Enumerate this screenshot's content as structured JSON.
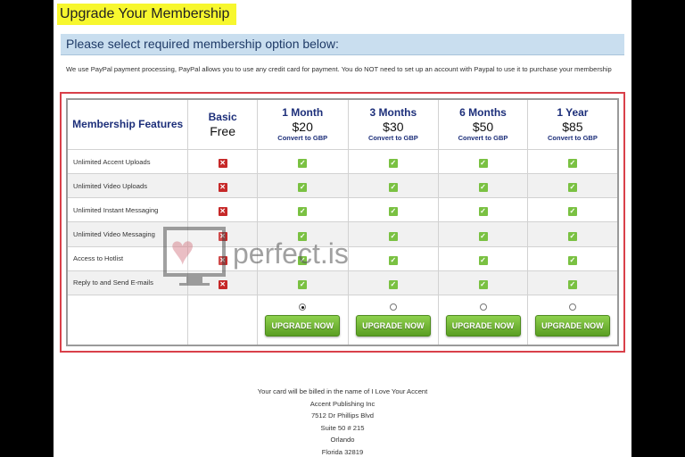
{
  "header": {
    "title": "Upgrade Your Membership",
    "subtitle": "Please select required membership option below:",
    "intro": "We use PayPal payment processing, PayPal allows you to use any credit card for payment. You do NOT need to set up an account with Paypal to use it to purchase your membership"
  },
  "table": {
    "features_header": "Membership Features",
    "plans": [
      {
        "name": "Basic",
        "price": "Free",
        "convert": "",
        "selected": false,
        "upgrade": ""
      },
      {
        "name": "1 Month",
        "price": "$20",
        "convert": "Convert to GBP",
        "selected": true,
        "upgrade": "UPGRADE NOW"
      },
      {
        "name": "3 Months",
        "price": "$30",
        "convert": "Convert to GBP",
        "selected": false,
        "upgrade": "UPGRADE NOW"
      },
      {
        "name": "6 Months",
        "price": "$50",
        "convert": "Convert to GBP",
        "selected": false,
        "upgrade": "UPGRADE NOW"
      },
      {
        "name": "1 Year",
        "price": "$85",
        "convert": "Convert to GBP",
        "selected": false,
        "upgrade": "UPGRADE NOW"
      }
    ],
    "features": [
      "Unlimited Accent Uploads",
      "Unlimited Video Uploads",
      "Unlimited Instant Messaging",
      "Unlimited Video Messaging",
      "Access to Hotlist",
      "Reply to and Send E-mails"
    ],
    "icons": {
      "no": "x-icon",
      "yes": "check-icon"
    }
  },
  "footer": {
    "lines": [
      "Your card will be billed in the name of I Love Your Accent",
      "Accent Publishing Inc",
      "7512 Dr Phillips Blvd",
      "Suite 50 # 215",
      "Orlando",
      "Florida 32819"
    ]
  },
  "watermark": {
    "text": "perfect.is"
  },
  "colors": {
    "accent": "#1d2f7a",
    "highlight": "#f7f72e",
    "frame": "#d9404a",
    "button": "#6cb32e"
  }
}
